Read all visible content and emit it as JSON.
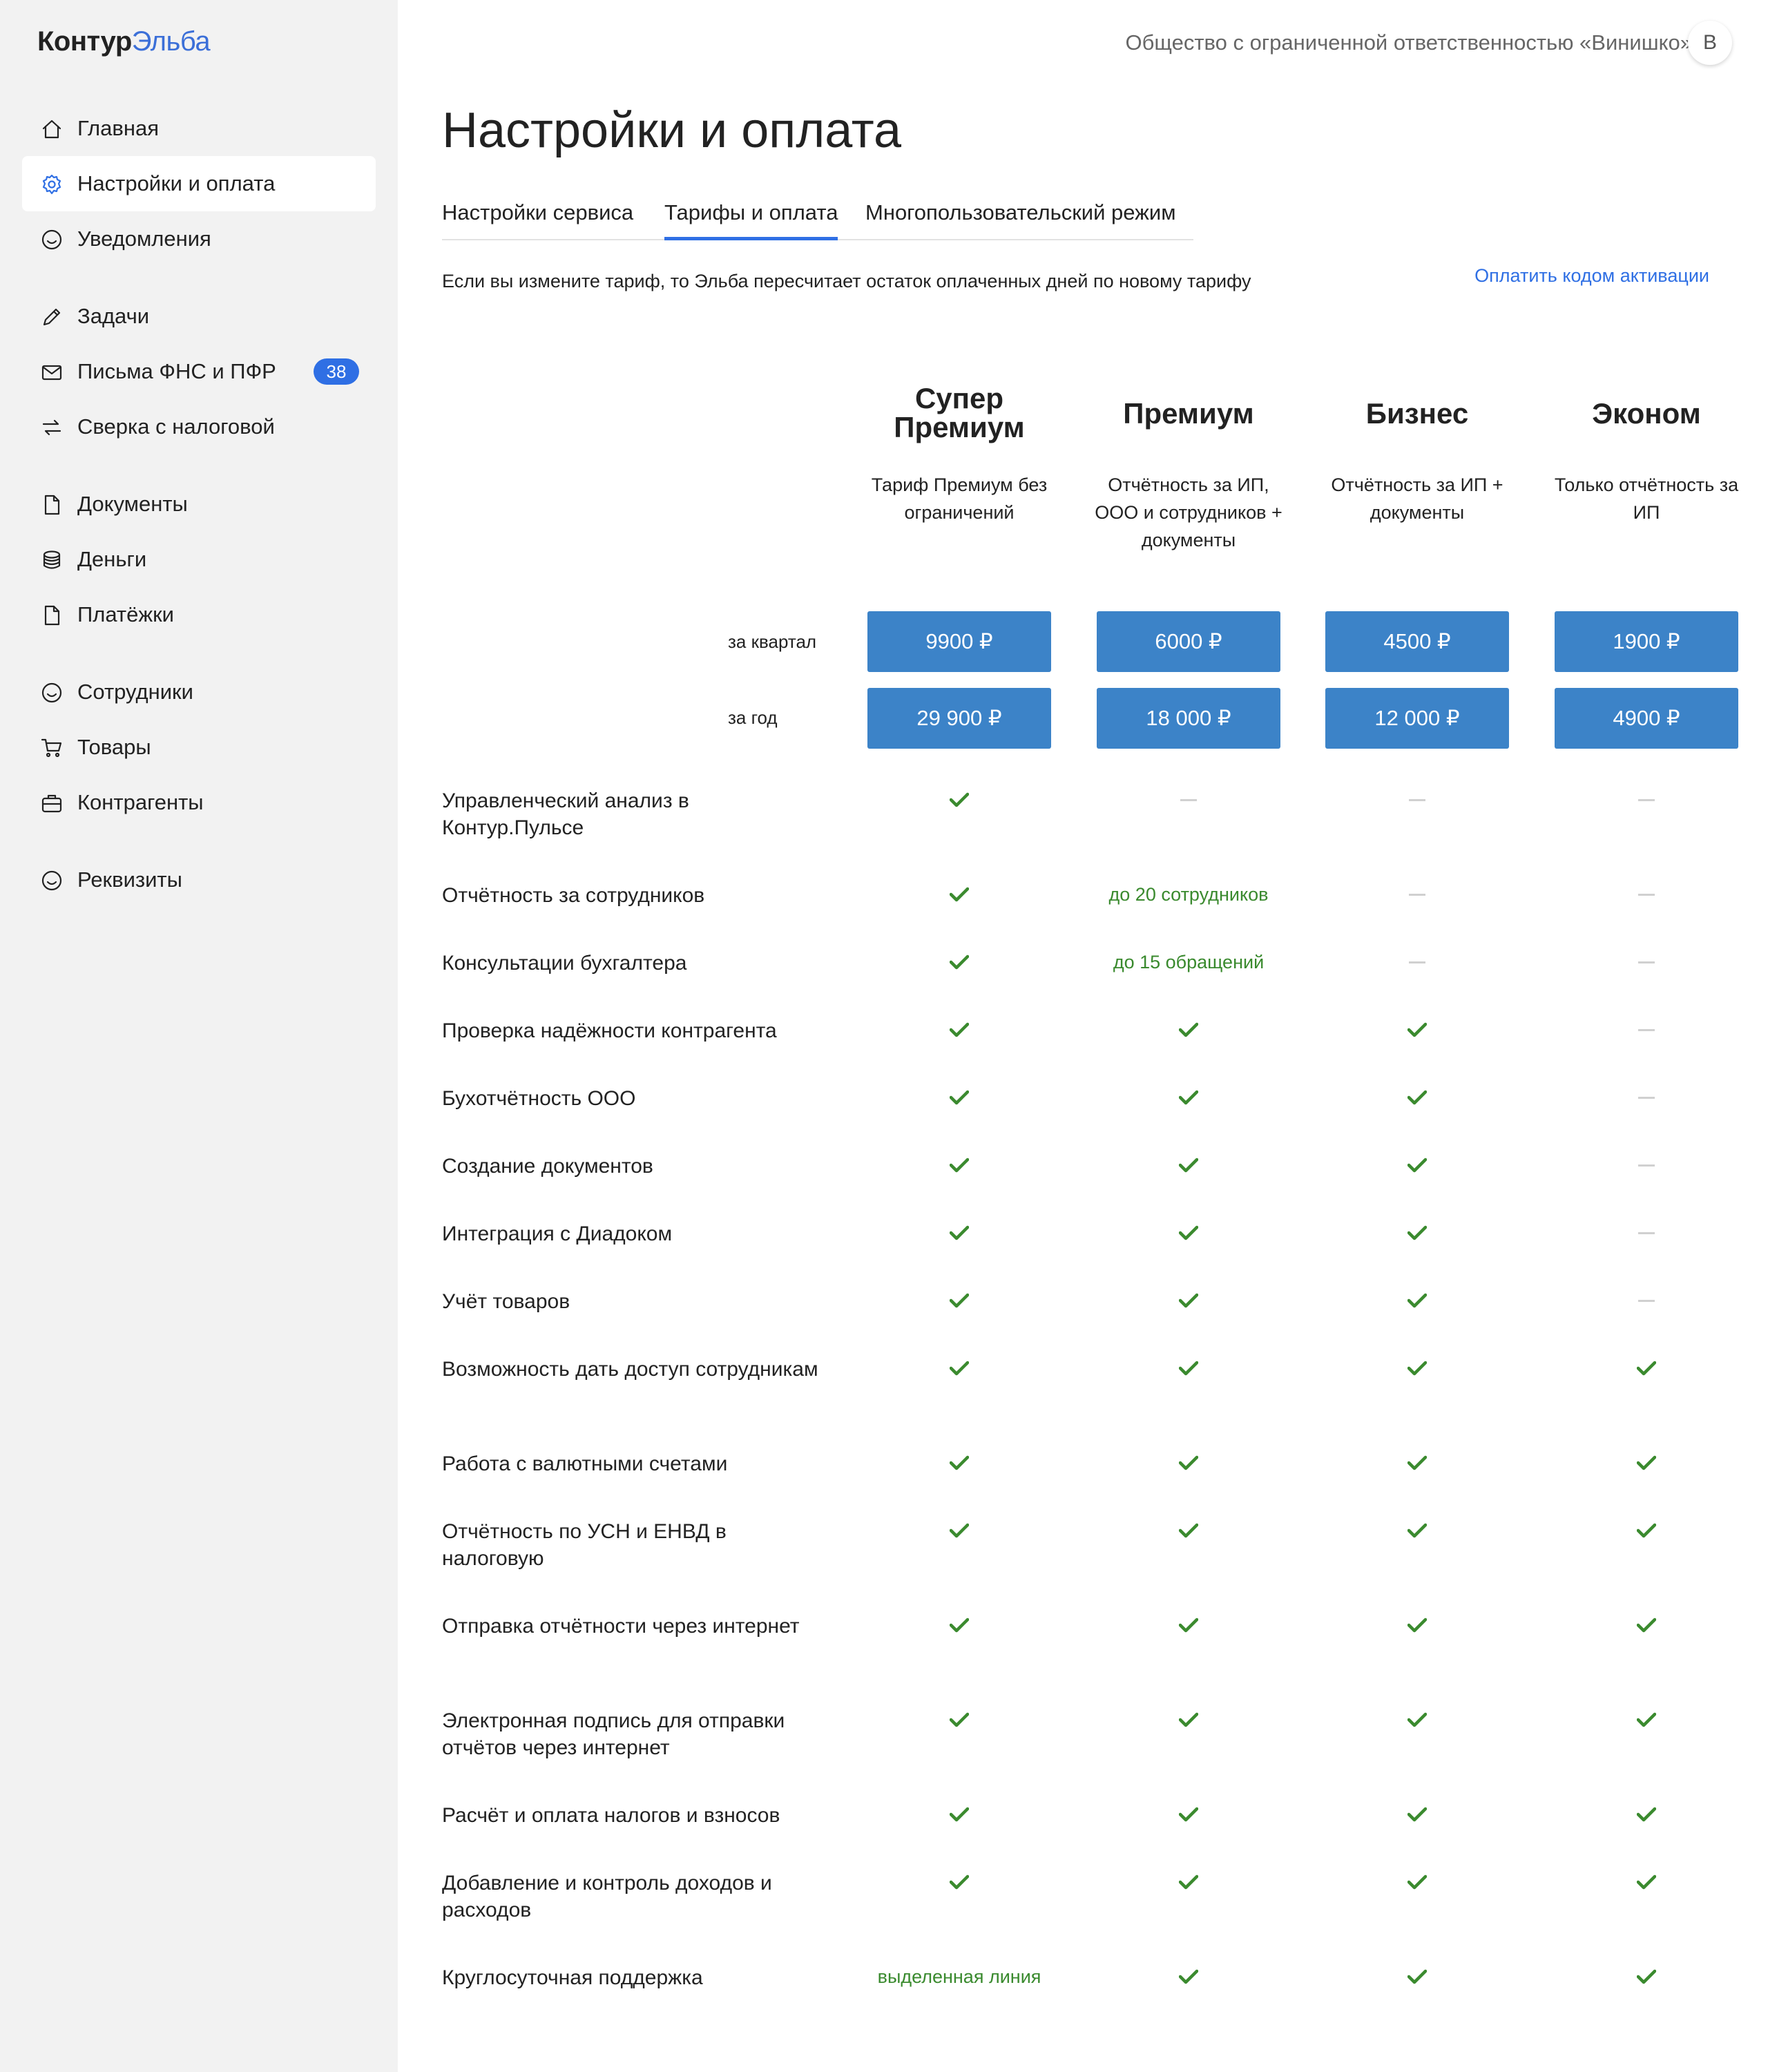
{
  "app": {
    "logo_brand": "Контур",
    "logo_product": "Эльба"
  },
  "sidebar": {
    "items": [
      {
        "label": "Главная",
        "icon": "home-icon"
      },
      {
        "label": "Настройки и оплата",
        "icon": "gear-icon",
        "active": true
      },
      {
        "label": "Уведомления",
        "icon": "smile-icon"
      },
      {
        "label": "Задачи",
        "icon": "pencil-icon"
      },
      {
        "label": "Письма ФНС и ПФР",
        "icon": "mail-icon",
        "badge": "38"
      },
      {
        "label": "Сверка с налоговой",
        "icon": "sync-icon"
      },
      {
        "label": "Документы",
        "icon": "document-icon"
      },
      {
        "label": "Деньги",
        "icon": "coins-icon"
      },
      {
        "label": "Платёжки",
        "icon": "payment-document-icon"
      },
      {
        "label": "Сотрудники",
        "icon": "smile-icon"
      },
      {
        "label": "Товары",
        "icon": "cart-icon"
      },
      {
        "label": "Контрагенты",
        "icon": "briefcase-icon"
      },
      {
        "label": "Реквизиты",
        "icon": "smile-icon"
      }
    ],
    "badge_color": "#2f6fe4"
  },
  "header": {
    "organization": "Общество с ограниченной ответственностью «Винишко»",
    "avatar_letter": "В"
  },
  "page": {
    "title": "Настройки и оплата",
    "tabs": [
      "Настройки сервиса",
      "Тарифы и оплата",
      "Многопользовательский режим"
    ],
    "active_tab": 1,
    "notice": "Если вы измените тариф, то Эльба пересчитает остаток оплаченных дней по новому тарифу",
    "activation_link": "Оплатить кодом активации"
  },
  "pricing": {
    "period_labels": {
      "quarter": "за квартал",
      "year": "за год"
    },
    "plans": [
      {
        "name": "Супер Премиум",
        "desc": "Тариф Премиум без ограничений",
        "quarter": "9900 ₽",
        "year": "29 900 ₽"
      },
      {
        "name": "Премиум",
        "desc": "Отчётность за ИП, ООО и сотрудников + документы",
        "quarter": "6000 ₽",
        "year": "18 000 ₽"
      },
      {
        "name": "Бизнес",
        "desc": "Отчётность за ИП + документы",
        "quarter": "4500 ₽",
        "year": "12 000 ₽"
      },
      {
        "name": "Эконом",
        "desc": "Только отчётность за ИП",
        "quarter": "1900 ₽",
        "year": "4900 ₽"
      }
    ],
    "button_color": "#3c83c8",
    "check_color": "#3a8a2e",
    "features": [
      {
        "label": "Управленческий анализ в Контур.Пульсе",
        "values": [
          "check",
          "dash",
          "dash",
          "dash"
        ]
      },
      {
        "label": "Отчётность за сотрудников",
        "values": [
          "check",
          "до 20 сотрудников",
          "dash",
          "dash"
        ]
      },
      {
        "label": "Консультации бухгалтера",
        "values": [
          "check",
          "до 15 обращений",
          "dash",
          "dash"
        ]
      },
      {
        "label": "Проверка надёжности контрагента",
        "values": [
          "check",
          "check",
          "check",
          "dash"
        ]
      },
      {
        "label": "Бухотчётность ООО",
        "values": [
          "check",
          "check",
          "check",
          "dash"
        ]
      },
      {
        "label": "Создание документов",
        "values": [
          "check",
          "check",
          "check",
          "dash"
        ]
      },
      {
        "label": "Интеграция с Диадоком",
        "values": [
          "check",
          "check",
          "check",
          "dash"
        ]
      },
      {
        "label": "Учёт товаров",
        "values": [
          "check",
          "check",
          "check",
          "dash"
        ]
      },
      {
        "label": "Возможность дать доступ сотрудникам",
        "values": [
          "check",
          "check",
          "check",
          "check"
        ]
      },
      {
        "label": "Работа с валютными счетами",
        "values": [
          "check",
          "check",
          "check",
          "check"
        ]
      },
      {
        "label": "Отчётность по УСН и ЕНВД в налоговую",
        "values": [
          "check",
          "check",
          "check",
          "check"
        ]
      },
      {
        "label": "Отправка отчётности через интернет",
        "values": [
          "check",
          "check",
          "check",
          "check"
        ]
      },
      {
        "label": "Электронная подпись для отправки отчётов через интернет",
        "values": [
          "check",
          "check",
          "check",
          "check"
        ]
      },
      {
        "label": "Расчёт и оплата налогов и взносов",
        "values": [
          "check",
          "check",
          "check",
          "check"
        ]
      },
      {
        "label": "Добавление и контроль доходов и расходов",
        "values": [
          "check",
          "check",
          "check",
          "check"
        ]
      },
      {
        "label": "Круглосуточная поддержка",
        "values": [
          "выделенная линия",
          "check",
          "check",
          "check"
        ]
      }
    ]
  }
}
